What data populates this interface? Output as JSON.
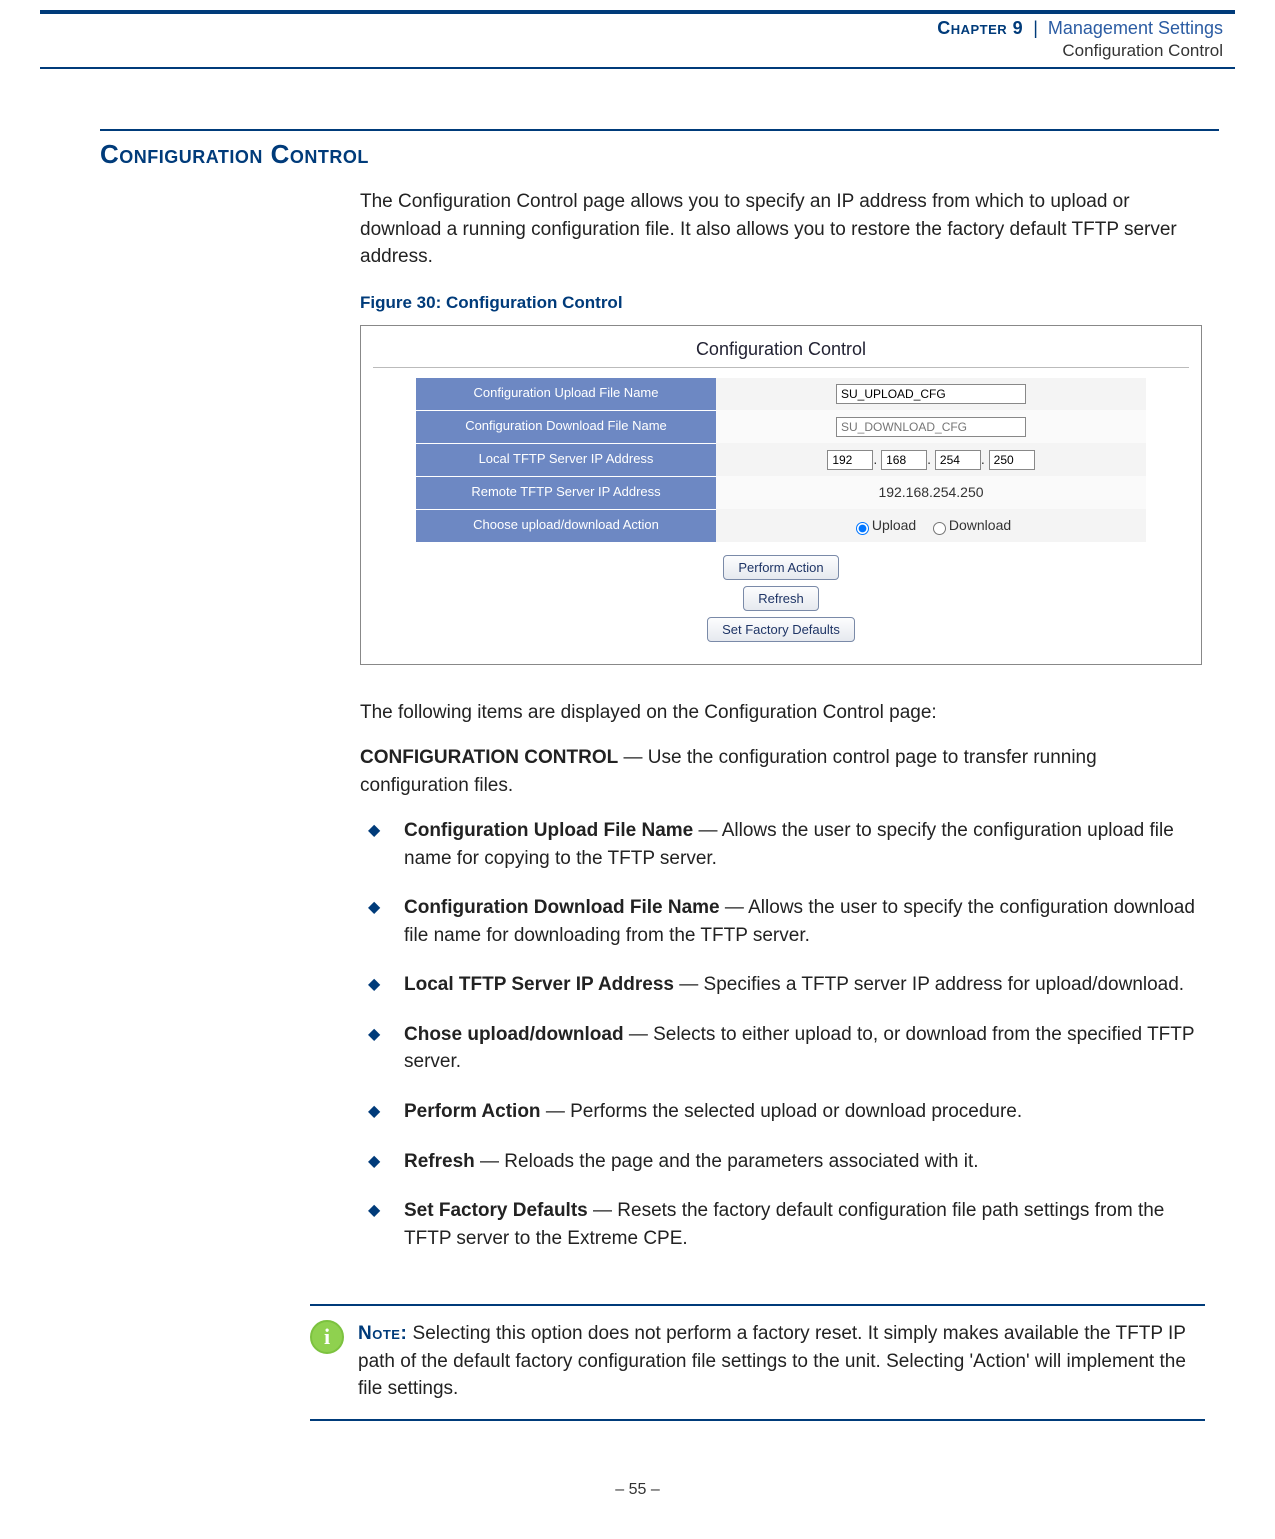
{
  "running_header": {
    "chapter_label": "Chapter 9",
    "separator": "|",
    "chapter_title": "Management Settings",
    "section_title": "Configuration Control"
  },
  "section_heading": "Configuration Control",
  "intro_para": "The Configuration Control page allows you to specify an IP address from which to upload or download a running configuration file. It also allows you to restore the factory default TFTP server address.",
  "figure_caption": "Figure 30:  Configuration Control",
  "ui": {
    "title": "Configuration Control",
    "rows": {
      "upload_name": {
        "label": "Configuration Upload File Name",
        "value": "SU_UPLOAD_CFG"
      },
      "download_name": {
        "label": "Configuration Download File Name",
        "placeholder": "SU_DOWNLOAD_CFG"
      },
      "local_ip": {
        "label": "Local TFTP Server IP Address",
        "oct1": "192",
        "dot": ".",
        "oct2": "168",
        "oct3": "254",
        "oct4": "250"
      },
      "remote_ip": {
        "label": "Remote TFTP Server IP Address",
        "value": "192.168.254.250"
      },
      "action": {
        "label": "Choose upload/download Action",
        "upload": "Upload",
        "download": "Download"
      }
    },
    "buttons": {
      "perform": "Perform Action",
      "refresh": "Refresh",
      "factory": "Set Factory Defaults"
    }
  },
  "lead_sentence": "The following items are displayed on the Configuration Control page:",
  "cc_lead_bold": "CONFIGURATION CONTROL",
  "cc_lead_rest": " — Use the configuration control page to transfer running configuration files.",
  "bullets": [
    {
      "term": "Configuration Upload File Name",
      "rest": " — Allows the user to specify the configuration upload file name for copying to the TFTP server."
    },
    {
      "term": "Configuration Download File Name",
      "rest": " — Allows the user to specify the configuration download file name for downloading from the TFTP server."
    },
    {
      "term": "Local TFTP Server IP Address",
      "rest": " — Specifies a TFTP server IP address for upload/download."
    },
    {
      "term": "Chose upload/download",
      "rest": " — Selects to either upload to, or download from the specified TFTP server."
    },
    {
      "term": "Perform Action",
      "rest": " — Performs the selected upload or download procedure."
    },
    {
      "term": "Refresh",
      "rest": " — Reloads the page and the parameters associated with it."
    },
    {
      "term": "Set Factory Defaults",
      "rest": " — Resets the factory default configuration file path settings from the TFTP server to the Extreme CPE."
    }
  ],
  "note": {
    "lead": "Note:",
    "body": " Selecting this option does not perform a factory reset. It simply makes available the TFTP IP path of the default factory configuration file settings to the unit. Selecting 'Action' will implement the file settings."
  },
  "footer": "–  55  –"
}
